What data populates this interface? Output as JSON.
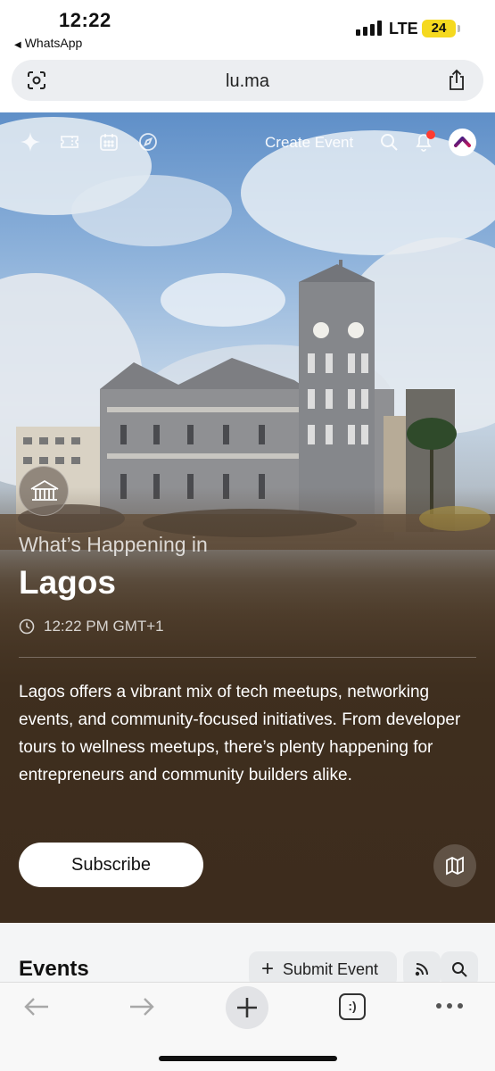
{
  "status_bar": {
    "time": "12:22",
    "back_app": "WhatsApp",
    "network": "LTE",
    "battery": "24"
  },
  "browser": {
    "url": "lu.ma",
    "left_icon": "camera-scan-icon",
    "right_icon": "share-icon"
  },
  "hero": {
    "nav_icons": [
      "sparkle-icon",
      "ticket-icon",
      "calendar-icon",
      "compass-icon"
    ],
    "create_event": "Create Event",
    "whats_happening": "What’s Happening in",
    "city": "Lagos",
    "local_time": "12:22 PM GMT+1",
    "description": "Lagos offers a vibrant mix of tech meetups, networking events, and community-focused initiatives. From developer tours to wellness meetups, there’s plenty happening for entrepreneurs and community builders alike.",
    "subscribe": "Subscribe",
    "map_icon": "map-icon"
  },
  "events": {
    "title": "Events",
    "submit_event": "Submit Event",
    "rss_icon": "rss-icon",
    "search_icon": "search-icon"
  },
  "toolbar": {
    "icons": [
      "back-arrow-icon",
      "forward-arrow-icon",
      "new-tab-plus-icon",
      "tabs-icon",
      "more-icon"
    ],
    "tabs_label": ":)"
  },
  "colors": {
    "notification_dot": "#ff3b30",
    "battery": "#f5d91f",
    "hero_shade": "#3d2c1d"
  }
}
